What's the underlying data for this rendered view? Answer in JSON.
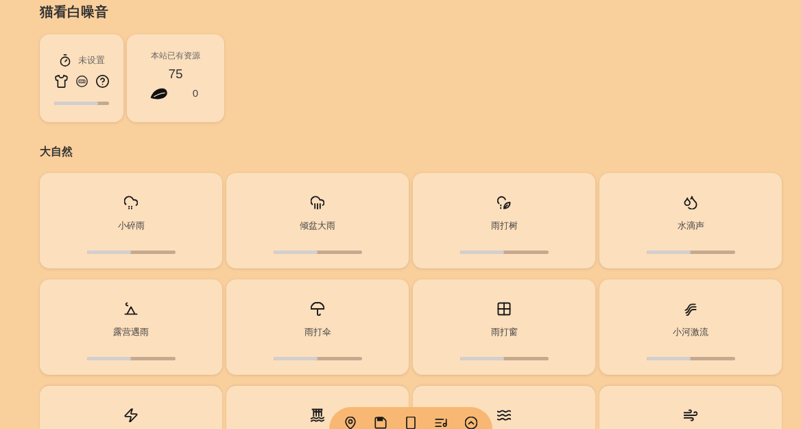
{
  "title": "猫看白噪音",
  "timer_card": {
    "label": "未设置",
    "level": 0.8
  },
  "resource_card": {
    "label": "本站已有资源",
    "count": "75",
    "leaf_count": "0"
  },
  "sections": [
    {
      "heading": "大自然",
      "sounds": [
        {
          "kind": "drizzle",
          "label": "小碎雨",
          "level": 0.5
        },
        {
          "kind": "downpour",
          "label": "倾盆大雨",
          "level": 0.5
        },
        {
          "kind": "rain-tree",
          "label": "雨打树",
          "level": 0.5
        },
        {
          "kind": "droplets",
          "label": "水滴声",
          "level": 0.5
        },
        {
          "kind": "tent",
          "label": "露营遇雨",
          "level": 0.5
        },
        {
          "kind": "umbrella",
          "label": "雨打伞",
          "level": 0.5
        },
        {
          "kind": "window",
          "label": "雨打窗",
          "level": 0.5
        },
        {
          "kind": "stream",
          "label": "小河激流",
          "level": 0.5
        },
        {
          "kind": "thunder"
        },
        {
          "kind": "waterfall"
        },
        {
          "kind": "waves"
        },
        {
          "kind": "wind"
        }
      ]
    }
  ]
}
